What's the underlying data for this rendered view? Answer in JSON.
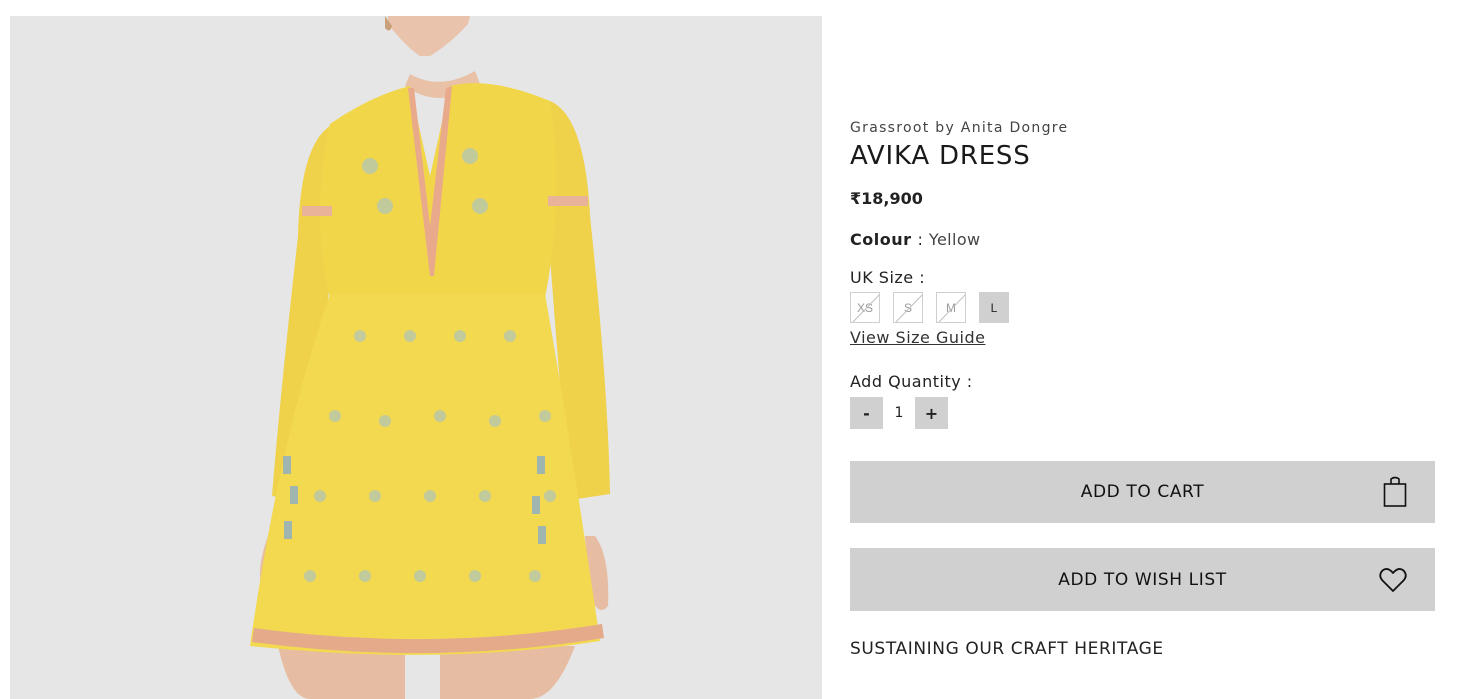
{
  "product": {
    "brand": "Grassroot by Anita Dongre",
    "name": "AVIKA DRESS",
    "price": "₹18,900",
    "image_alt": "Model wearing yellow embroidered dress"
  },
  "colour": {
    "label": "Colour",
    "separator": ":",
    "value": "Yellow"
  },
  "size": {
    "label": "UK Size  :",
    "options": [
      {
        "label": "XS",
        "available": false
      },
      {
        "label": "S",
        "available": false
      },
      {
        "label": "M",
        "available": false
      },
      {
        "label": "L",
        "available": true,
        "selected": true
      }
    ],
    "guide_link": "View Size Guide"
  },
  "quantity": {
    "label": "Add Quantity :",
    "decrement": "-",
    "value": "1",
    "increment": "+"
  },
  "actions": {
    "add_to_cart": "ADD TO CART",
    "add_to_wishlist": "ADD TO WISH LIST"
  },
  "heritage": "SUSTAINING OUR CRAFT HERITAGE",
  "icons": {
    "cart": "shopping-bag-icon",
    "wishlist": "heart-icon"
  },
  "colors": {
    "button_bg": "#cfd0cf",
    "dress": "#f2d64a",
    "image_bg": "#e6e6e6"
  }
}
